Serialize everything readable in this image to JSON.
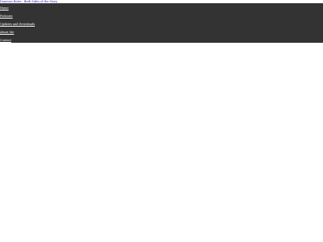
{
  "header": {
    "site_link": "Donovan Roles - Both Sides of the Story"
  },
  "nav": {
    "items": [
      {
        "label": "Home"
      },
      {
        "label": "Podcasts"
      },
      {
        "label": "Updates and Downloads"
      },
      {
        "label": "About Me"
      },
      {
        "label": "Contact"
      }
    ]
  },
  "colors": {
    "nav_background": "#333333",
    "nav_text": "#ffffff",
    "link": "#1a0dab",
    "page_background": "#ffffff"
  }
}
